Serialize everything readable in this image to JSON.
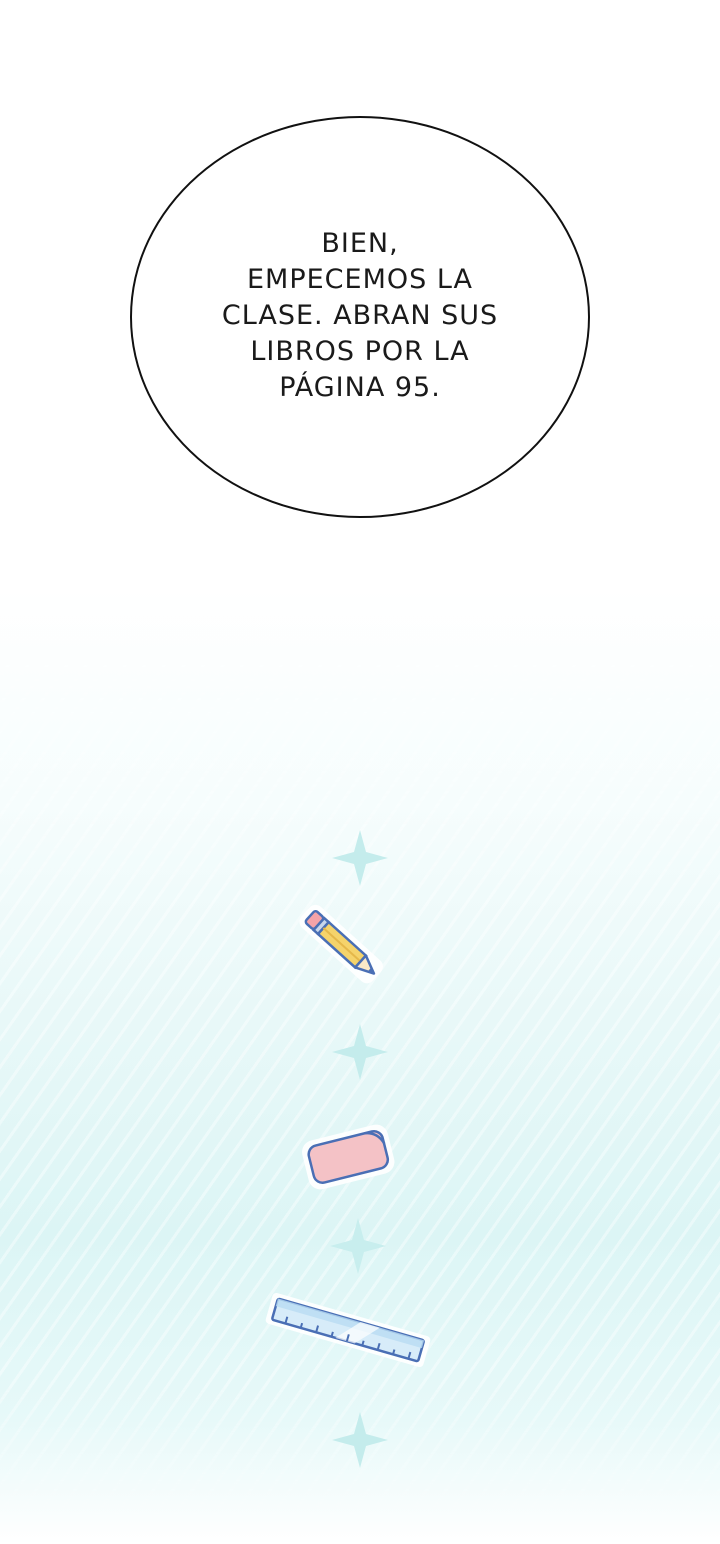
{
  "speech_bubble": {
    "lines": [
      "BIEN,",
      "EMPECEMOS LA",
      "CLASE. ABRAN SUS",
      "LIBROS POR LA",
      "PÁGINA 95."
    ]
  },
  "decorations": [
    "sparkle-icon",
    "pencil-icon",
    "sparkle-icon",
    "eraser-icon",
    "sparkle-icon",
    "ruler-icon",
    "sparkle-icon"
  ],
  "colors": {
    "background_tint": "#dcf5f5",
    "sparkle": "#c4ecec",
    "outline": "#4a6fb5",
    "pencil_body": "#f5d36b",
    "eraser": "#f4c2c6",
    "ruler": "#cfe8f8"
  }
}
